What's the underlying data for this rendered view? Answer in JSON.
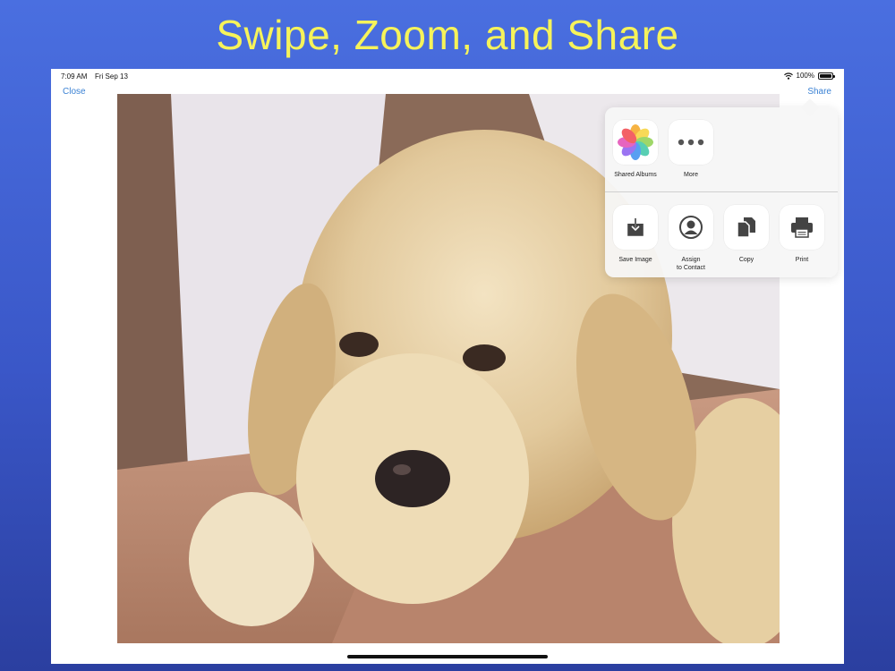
{
  "slide": {
    "title": "Swipe, Zoom, and Share"
  },
  "status_bar": {
    "time": "7:09 AM",
    "date": "Fri Sep 13",
    "battery": "100%"
  },
  "nav": {
    "close_label": "Close",
    "share_label": "Share"
  },
  "share_sheet": {
    "top_row": [
      {
        "label": "Shared Albums",
        "icon": "photos-pinwheel-icon"
      },
      {
        "label": "More",
        "icon": "more-ellipsis-icon"
      }
    ],
    "actions": [
      {
        "label": "Save Image",
        "icon": "save-image-icon"
      },
      {
        "label_line1": "Assign",
        "label_line2": "to Contact",
        "icon": "contact-icon"
      },
      {
        "label": "Copy",
        "icon": "copy-icon"
      },
      {
        "label": "Print",
        "icon": "printer-icon"
      }
    ]
  },
  "colors": {
    "slide_title": "#f6f35a",
    "link": "#3b82d4",
    "background_top": "#4a6fe0",
    "background_bottom": "#2b3fa0"
  }
}
